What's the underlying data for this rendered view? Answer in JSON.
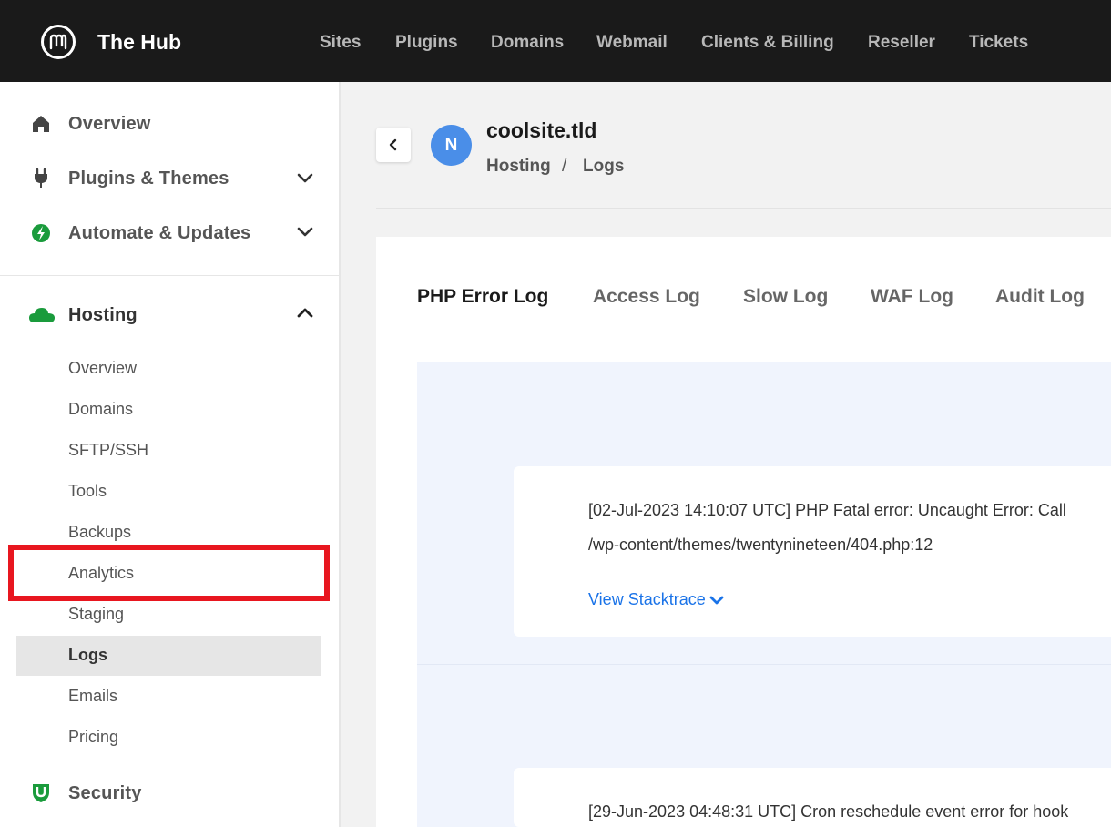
{
  "app": {
    "brand": "The Hub"
  },
  "topnav": [
    "Sites",
    "Plugins",
    "Domains",
    "Webmail",
    "Clients & Billing",
    "Reseller",
    "Tickets"
  ],
  "sidebar": {
    "main": {
      "overview": "Overview",
      "plugins_themes": "Plugins & Themes",
      "automate": "Automate & Updates",
      "hosting": "Hosting",
      "security": "Security"
    },
    "hosting_items": [
      "Overview",
      "Domains",
      "SFTP/SSH",
      "Tools",
      "Backups",
      "Analytics",
      "Staging",
      "Logs",
      "Emails",
      "Pricing"
    ],
    "active_item": "Logs"
  },
  "header": {
    "avatar_letter": "N",
    "site": "coolsite.tld",
    "breadcrumb": [
      "Hosting",
      "/",
      "Logs"
    ]
  },
  "tabs": [
    "PHP Error Log",
    "Access Log",
    "Slow Log",
    "WAF Log",
    "Audit Log"
  ],
  "active_tab": "PHP Error Log",
  "logs": [
    {
      "line1": "[02-Jul-2023 14:10:07 UTC] PHP Fatal error: Uncaught Error: Call",
      "line2": "/wp-content/themes/twentynineteen/404.php:12",
      "link": "View Stacktrace"
    },
    {
      "line1": "[29-Jun-2023 04:48:31 UTC] Cron reschedule event error for hook"
    }
  ],
  "colors": {
    "topbar": "#1a1a1a",
    "accent_blue": "#4a8ee8",
    "link_blue": "#1a73e8",
    "green_icon": "#1a9b3c",
    "highlight_red": "#e8161f",
    "log_bg": "#f0f4fd"
  }
}
